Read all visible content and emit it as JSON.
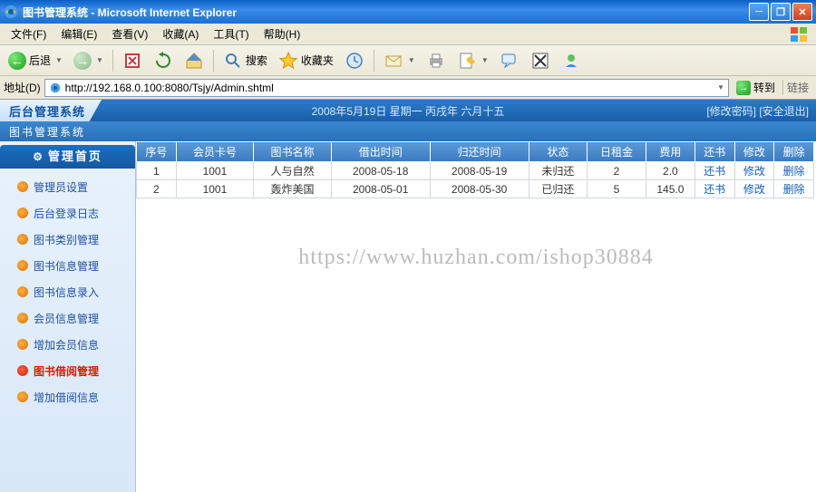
{
  "window": {
    "title": "图书管理系统 - Microsoft Internet Explorer"
  },
  "menubar": {
    "file": "文件(F)",
    "edit": "编辑(E)",
    "view": "查看(V)",
    "favorites": "收藏(A)",
    "tools": "工具(T)",
    "help": "帮助(H)"
  },
  "toolbar": {
    "back": "后退",
    "search": "搜索",
    "favorites": "收藏夹"
  },
  "address": {
    "label": "地址(D)",
    "url": "http://192.168.0.100:8080/Tsjy/Admin.shtml",
    "go": "转到",
    "links": "链接"
  },
  "app": {
    "system_name": "后台管理系统",
    "date_info": "2008年5月19日 星期一 丙戌年 六月十五",
    "change_password": "[修改密码]",
    "logout": "[安全退出]",
    "subtitle": "图书管理系统"
  },
  "sidebar": {
    "title": "管理首页",
    "items": [
      {
        "label": "管理员设置"
      },
      {
        "label": "后台登录日志"
      },
      {
        "label": "图书类别管理"
      },
      {
        "label": "图书信息管理"
      },
      {
        "label": "图书信息录入"
      },
      {
        "label": "会员信息管理"
      },
      {
        "label": "增加会员信息"
      },
      {
        "label": "图书借阅管理"
      },
      {
        "label": "增加借阅信息"
      }
    ],
    "selected_index": 7
  },
  "table": {
    "headers": [
      "序号",
      "会员卡号",
      "图书名称",
      "借出时间",
      "归还时间",
      "状态",
      "日租金",
      "费用",
      "还书",
      "修改",
      "删除"
    ],
    "rows": [
      {
        "no": "1",
        "card": "1001",
        "book": "人与自然",
        "borrow": "2008-05-18",
        "return": "2008-05-19",
        "status": "未归还",
        "daily": "2",
        "fee": "2.0",
        "ret": "还书",
        "edit": "修改",
        "del": "删除"
      },
      {
        "no": "2",
        "card": "1001",
        "book": "轰炸美国",
        "borrow": "2008-05-01",
        "return": "2008-05-30",
        "status": "已归还",
        "daily": "5",
        "fee": "145.0",
        "ret": "还书",
        "edit": "修改",
        "del": "删除"
      }
    ]
  },
  "watermark": "https://www.huzhan.com/ishop30884"
}
